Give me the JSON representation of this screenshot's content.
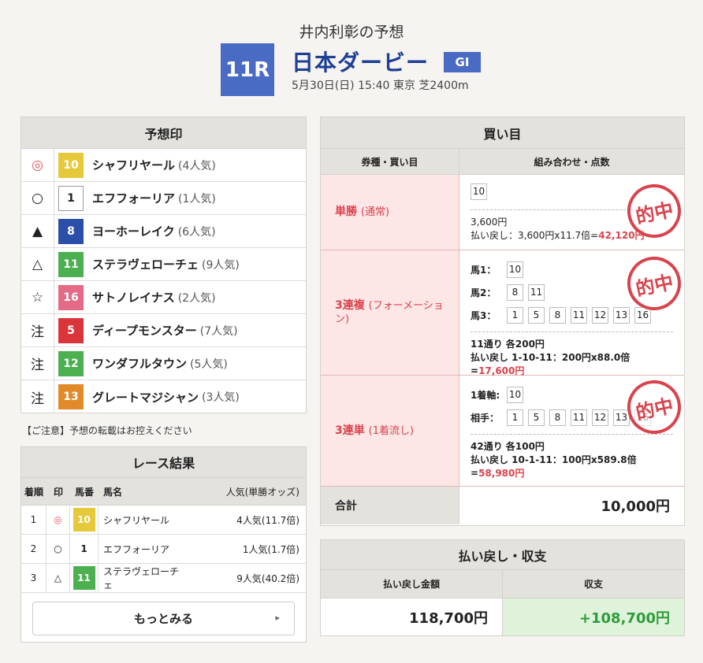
{
  "header": {
    "title": "井内利彰の予想",
    "race_no": "11R",
    "race_name": "日本ダービー",
    "grade": "GI",
    "info": "5月30日(日) 15:40 東京 芝2400m"
  },
  "picks": {
    "heading": "予想印",
    "items": [
      {
        "mark": "◎",
        "num": "10",
        "color": "#e6c93a",
        "text_color": "#ffffff",
        "name": "シャフリヤール",
        "pop": "(4人気)"
      },
      {
        "mark": "○",
        "num": "1",
        "color": "#ffffff",
        "text_color": "#222222",
        "name": "エフフォーリア",
        "pop": "(1人気)"
      },
      {
        "mark": "▲",
        "num": "8",
        "color": "#2b4fa8",
        "text_color": "#ffffff",
        "name": "ヨーホーレイク",
        "pop": "(6人気)"
      },
      {
        "mark": "△",
        "num": "11",
        "color": "#4caf50",
        "text_color": "#ffffff",
        "name": "ステラヴェローチェ",
        "pop": "(9人気)"
      },
      {
        "mark": "☆",
        "num": "16",
        "color": "#e46a87",
        "text_color": "#ffffff",
        "name": "サトノレイナス",
        "pop": "(2人気)"
      },
      {
        "mark": "注",
        "num": "5",
        "color": "#d9363c",
        "text_color": "#ffffff",
        "name": "ディープモンスター",
        "pop": "(7人気)"
      },
      {
        "mark": "注",
        "num": "12",
        "color": "#4caf50",
        "text_color": "#ffffff",
        "name": "ワンダフルタウン",
        "pop": "(5人気)"
      },
      {
        "mark": "注",
        "num": "13",
        "color": "#e08a2a",
        "text_color": "#ffffff",
        "name": "グレートマジシャン",
        "pop": "(3人気)"
      }
    ]
  },
  "notice": "【ご注意】予想の転載はお控えください",
  "results": {
    "heading": "レース結果",
    "cols": [
      "着順",
      "印",
      "馬番",
      "馬名",
      "人気(単勝オッズ)"
    ],
    "rows": [
      {
        "pos": "1",
        "mark": "◎",
        "num": "10",
        "color": "#e6c93a",
        "text_color": "#ffffff",
        "name": "シャフリヤール",
        "pop": "4人気(11.7倍)"
      },
      {
        "pos": "2",
        "mark": "○",
        "num": "1",
        "color": "#ffffff",
        "text_color": "#222222",
        "name": "エフフォーリア",
        "pop": "1人気(1.7倍)"
      },
      {
        "pos": "3",
        "mark": "△",
        "num": "11",
        "color": "#4caf50",
        "text_color": "#ffffff",
        "name": "ステラヴェローチェ",
        "pop": "9人気(40.2倍)"
      }
    ],
    "more": "もっとみる"
  },
  "bets": {
    "heading": "買い目",
    "col1": "券種・買い目",
    "col2": "組み合わせ・点数",
    "stamp": "的中",
    "win": {
      "type": "単勝",
      "sub": "(通常)",
      "horse": "10",
      "amount": "3,600円",
      "payout_label": "払い戻し：3,600円x11.7倍=",
      "payout": "42,120円"
    },
    "trio": {
      "type": "3連複",
      "sub": "(フォーメーション)",
      "l1": "馬1：",
      "h1": [
        "10"
      ],
      "l2": "馬2：",
      "h2": [
        "8",
        "11"
      ],
      "l3": "馬3：",
      "h3": [
        "1",
        "5",
        "8",
        "11",
        "12",
        "13",
        "16"
      ],
      "summary": "11通り 各200円",
      "payout_label": "払い戻し 1-10-11：200円x88.0倍=",
      "payout": "17,600円"
    },
    "trifecta": {
      "type": "3連単",
      "sub": "(1着流し)",
      "l1": "1着軸:",
      "h1": [
        "10"
      ],
      "l2": "相手：",
      "h2": [
        "1",
        "5",
        "8",
        "11",
        "12",
        "13",
        "16"
      ],
      "summary": "42通り 各100円",
      "payout_label": "払い戻し 10-1-11：100円x589.8倍=",
      "payout": "58,980円"
    },
    "total_label": "合計",
    "total": "10,000円"
  },
  "payout": {
    "heading": "払い戻し・収支",
    "col1": "払い戻し金額",
    "col2": "収支",
    "amount": "118,700円",
    "balance": "+108,700円"
  }
}
